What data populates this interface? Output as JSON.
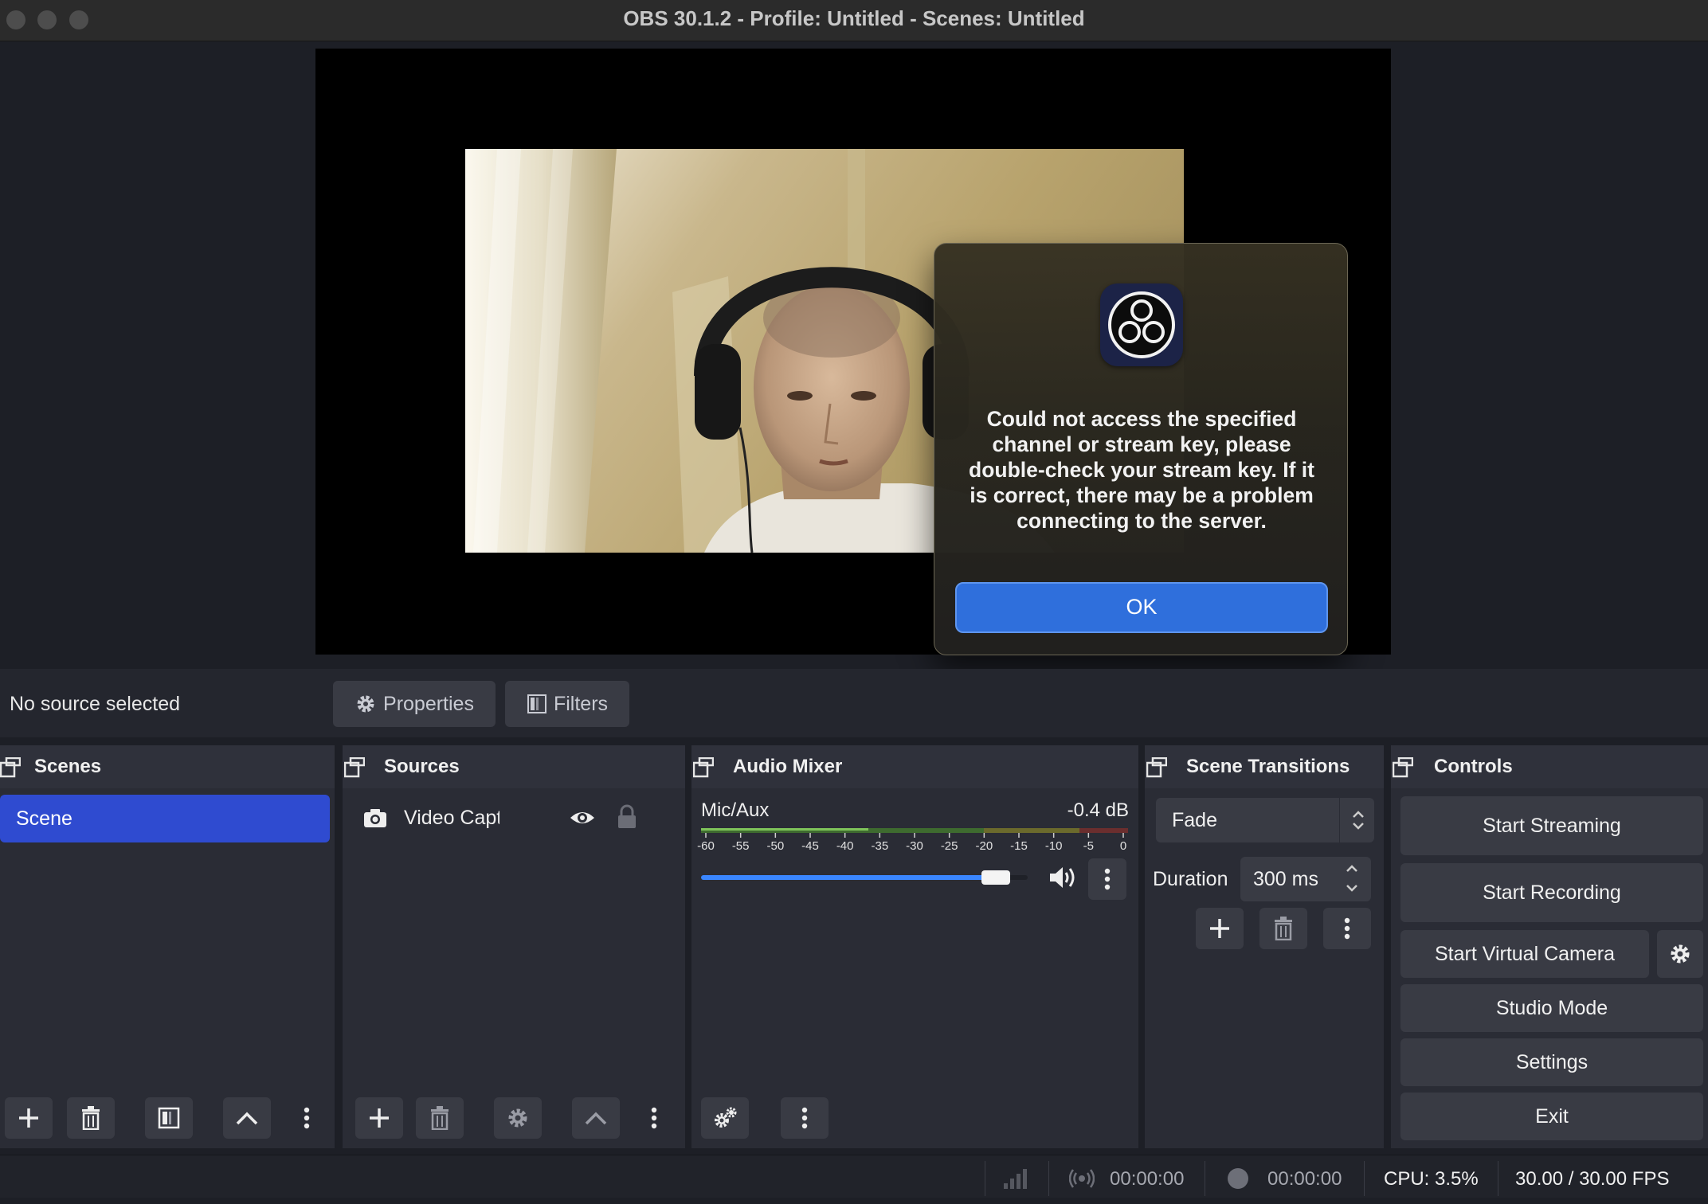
{
  "window": {
    "title": "OBS 30.1.2 - Profile: Untitled - Scenes: Untitled"
  },
  "dialog": {
    "message": "Could not access the specified channel or stream key, please double-check your stream key. If it is correct, there may be a problem connecting to the server.",
    "ok_label": "OK",
    "icon": "obs-logo-icon"
  },
  "source_bar": {
    "status": "No source selected",
    "properties_label": "Properties",
    "filters_label": "Filters"
  },
  "docks": {
    "scenes": {
      "title": "Scenes",
      "items": [
        {
          "label": "Scene",
          "selected": true
        }
      ]
    },
    "sources": {
      "title": "Sources",
      "items": [
        {
          "label": "Video Capture De",
          "visible": true,
          "locked": true,
          "icon": "camera-icon"
        }
      ]
    },
    "audio_mixer": {
      "title": "Audio Mixer",
      "channels": [
        {
          "name": "Mic/Aux",
          "level": "-0.4 dB",
          "volume_fraction": 0.94
        }
      ],
      "scale": [
        "-60",
        "-55",
        "-50",
        "-45",
        "-40",
        "-35",
        "-30",
        "-25",
        "-20",
        "-15",
        "-10",
        "-5",
        "0"
      ]
    },
    "scene_transitions": {
      "title": "Scene Transitions",
      "transition": "Fade",
      "duration_label": "Duration",
      "duration_value": "300 ms"
    },
    "controls": {
      "title": "Controls",
      "start_streaming": "Start Streaming",
      "start_recording": "Start Recording",
      "start_virtual_camera": "Start Virtual Camera",
      "studio_mode": "Studio Mode",
      "settings": "Settings",
      "exit": "Exit"
    }
  },
  "status_bar": {
    "stream_time": "00:00:00",
    "record_time": "00:00:00",
    "cpu": "CPU: 3.5%",
    "fps": "30.00 / 30.00 FPS"
  },
  "colors": {
    "accent": "#2f4bd0",
    "dialog_button": "#2f6fdc",
    "background": "#1d1f26",
    "dock": "#2a2c35"
  }
}
